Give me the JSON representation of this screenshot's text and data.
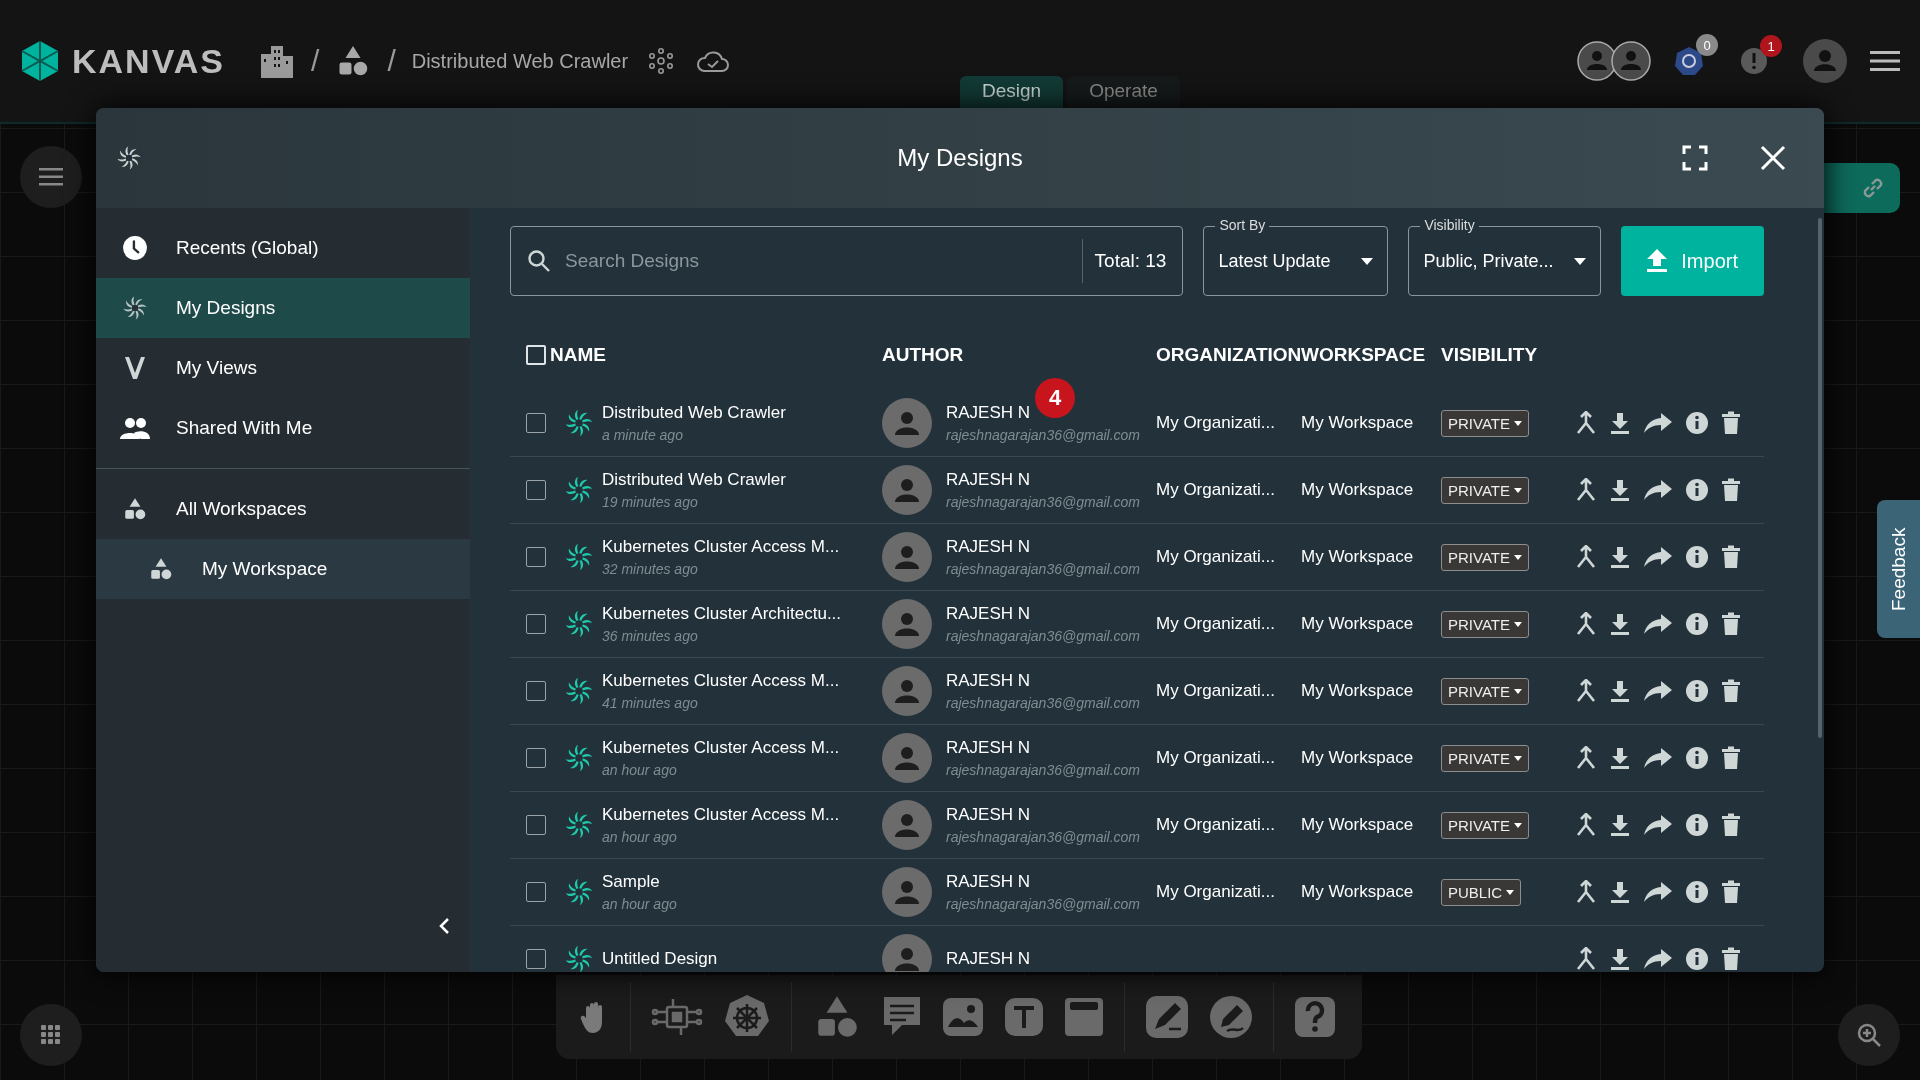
{
  "top_bar": {
    "logo": "KANVAS",
    "separators": [
      "/",
      "/"
    ],
    "design_name": "Distributed Web Crawler",
    "notification_count": "0",
    "alert_count": "1"
  },
  "mode_tabs": [
    {
      "label": "Design",
      "selected": true
    },
    {
      "label": "Operate",
      "selected": false
    }
  ],
  "modal": {
    "title": "My Designs",
    "sidebar": {
      "sections": [
        {
          "items": [
            {
              "label": "Recents (Global)",
              "kind": "recents",
              "selected": false
            },
            {
              "label": "My Designs",
              "kind": "designs",
              "selected": true
            },
            {
              "label": "My Views",
              "kind": "views",
              "selected": false
            },
            {
              "label": "Shared With Me",
              "kind": "shared",
              "selected": false
            }
          ]
        },
        {
          "items": [
            {
              "label": "All Workspaces",
              "kind": "workspaces",
              "selected": false,
              "children": [
                {
                  "label": "My Workspace",
                  "kind": "workspaces",
                  "selected": false
                }
              ]
            }
          ]
        }
      ]
    },
    "search": {
      "placeholder": "Search Designs",
      "total": "Total: 13"
    },
    "sort": {
      "label": "Sort By",
      "value": "Latest Update"
    },
    "visibility_filter": {
      "label": "Visibility",
      "value": "Public, Private..."
    },
    "import_button": "Import",
    "select_all_checked": false,
    "columns": [
      "NAME",
      "AUTHOR",
      "ORGANIZATION",
      "WORKSPACE",
      "VISIBILITY"
    ],
    "step_badge": "4",
    "rows": [
      {
        "name": "Distributed Web Crawler",
        "time": "a minute ago",
        "author": "RAJESH N",
        "email": "rajeshnagarajan36@gmail.com",
        "organization": "My Organizati...",
        "workspace": "My Workspace",
        "visibility": "PRIVATE",
        "checked": false
      },
      {
        "name": "Distributed Web Crawler",
        "time": "19 minutes ago",
        "author": "RAJESH N",
        "email": "rajeshnagarajan36@gmail.com",
        "organization": "My Organizati...",
        "workspace": "My Workspace",
        "visibility": "PRIVATE",
        "checked": false
      },
      {
        "name": "Kubernetes Cluster Access M...",
        "time": "32 minutes ago",
        "author": "RAJESH N",
        "email": "rajeshnagarajan36@gmail.com",
        "organization": "My Organizati...",
        "workspace": "My Workspace",
        "visibility": "PRIVATE",
        "checked": false
      },
      {
        "name": "Kubernetes Cluster Architectu...",
        "time": "36 minutes ago",
        "author": "RAJESH N",
        "email": "rajeshnagarajan36@gmail.com",
        "organization": "My Organizati...",
        "workspace": "My Workspace",
        "visibility": "PRIVATE",
        "checked": false
      },
      {
        "name": "Kubernetes Cluster Access M...",
        "time": "41 minutes ago",
        "author": "RAJESH N",
        "email": "rajeshnagarajan36@gmail.com",
        "organization": "My Organizati...",
        "workspace": "My Workspace",
        "visibility": "PRIVATE",
        "checked": false
      },
      {
        "name": "Kubernetes Cluster Access M...",
        "time": "an hour ago",
        "author": "RAJESH N",
        "email": "rajeshnagarajan36@gmail.com",
        "organization": "My Organizati...",
        "workspace": "My Workspace",
        "visibility": "PRIVATE",
        "checked": false
      },
      {
        "name": "Kubernetes Cluster Access M...",
        "time": "an hour ago",
        "author": "RAJESH N",
        "email": "rajeshnagarajan36@gmail.com",
        "organization": "My Organizati...",
        "workspace": "My Workspace",
        "visibility": "PRIVATE",
        "checked": false
      },
      {
        "name": "Sample",
        "time": "an hour ago",
        "author": "RAJESH N",
        "email": "rajeshnagarajan36@gmail.com",
        "organization": "My Organizati...",
        "workspace": "My Workspace",
        "visibility": "PUBLIC",
        "checked": false
      },
      {
        "name": "Untitled Design",
        "author": "RAJESH N",
        "checked": false
      }
    ]
  },
  "feedback": "Feedback"
}
